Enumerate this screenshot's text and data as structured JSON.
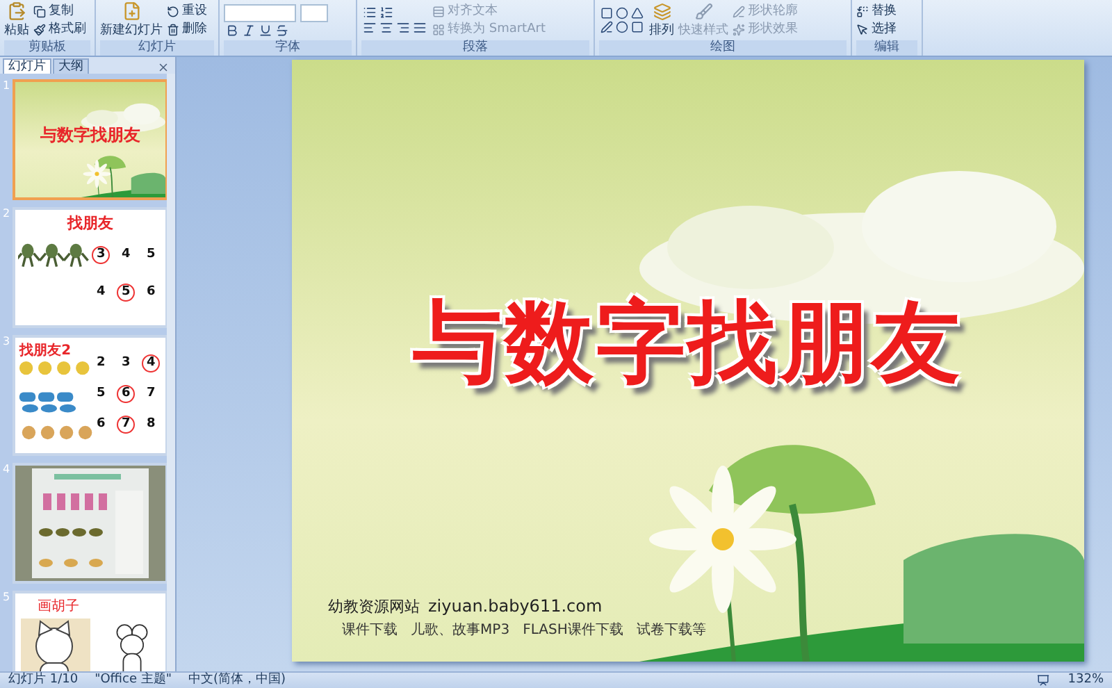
{
  "ribbon": {
    "groups": [
      {
        "kind": "clipboard",
        "label": "剪贴板",
        "big": "粘贴",
        "small": [
          "复制",
          "格式刷"
        ]
      },
      {
        "kind": "slides",
        "label": "幻灯片",
        "big": "新建幻灯片",
        "small": [
          "重设",
          "删除"
        ]
      },
      {
        "kind": "font",
        "label": "字体"
      },
      {
        "kind": "paragraph",
        "label": "段落",
        "small": [
          "对齐文本",
          "转换为 SmartArt"
        ]
      },
      {
        "kind": "drawing",
        "label": "绘图",
        "big": "排列",
        "mid": "快速样式",
        "small": [
          "形状轮廓",
          "形状效果"
        ]
      },
      {
        "kind": "editing",
        "label": "编辑",
        "small": [
          "替换",
          "选择"
        ]
      }
    ]
  },
  "slides_panel": {
    "tabs": [
      {
        "label": "幻灯片",
        "selected": true
      },
      {
        "label": "大纲",
        "selected": false
      }
    ],
    "slides": [
      {
        "number": "1",
        "selected": true,
        "kind": "title",
        "title": "与数字找朋友"
      },
      {
        "number": "2",
        "selected": false,
        "kind": "match",
        "title": "找朋友",
        "rows": [
          {
            "numbers": [
              {
                "text": "3",
                "circled": true
              },
              {
                "text": "4",
                "circled": false
              },
              {
                "text": "5",
                "circled": false
              }
            ]
          },
          {
            "numbers": [
              {
                "text": "4",
                "circled": false
              },
              {
                "text": "5",
                "circled": true
              },
              {
                "text": "6",
                "circled": false
              }
            ]
          }
        ]
      },
      {
        "number": "3",
        "selected": false,
        "kind": "match2",
        "title": "找朋友2",
        "rows": [
          {
            "numbers": [
              {
                "text": "2",
                "circled": false
              },
              {
                "text": "3",
                "circled": false
              },
              {
                "text": "4",
                "circled": true
              }
            ]
          },
          {
            "numbers": [
              {
                "text": "5",
                "circled": false
              },
              {
                "text": "6",
                "circled": true
              },
              {
                "text": "7",
                "circled": false
              }
            ]
          },
          {
            "numbers": [
              {
                "text": "6",
                "circled": false
              },
              {
                "text": "7",
                "circled": true
              },
              {
                "text": "8",
                "circled": false
              }
            ]
          }
        ]
      },
      {
        "number": "4",
        "selected": false,
        "kind": "picture"
      },
      {
        "number": "5",
        "selected": false,
        "kind": "drawings",
        "title": "画胡子"
      }
    ]
  },
  "slide": {
    "title": "与数字找朋友",
    "site_name": "幼教资源网站",
    "site_url": "ziyuan.baby611.com",
    "tagline": "课件下载   儿歌、故事MP3   FLASH课件下载   试卷下载等"
  },
  "status_bar": {
    "slide": "幻灯片 1/10",
    "theme": "\"Office 主题\"",
    "language": "中文(简体，中国)",
    "zoom": "132%"
  }
}
